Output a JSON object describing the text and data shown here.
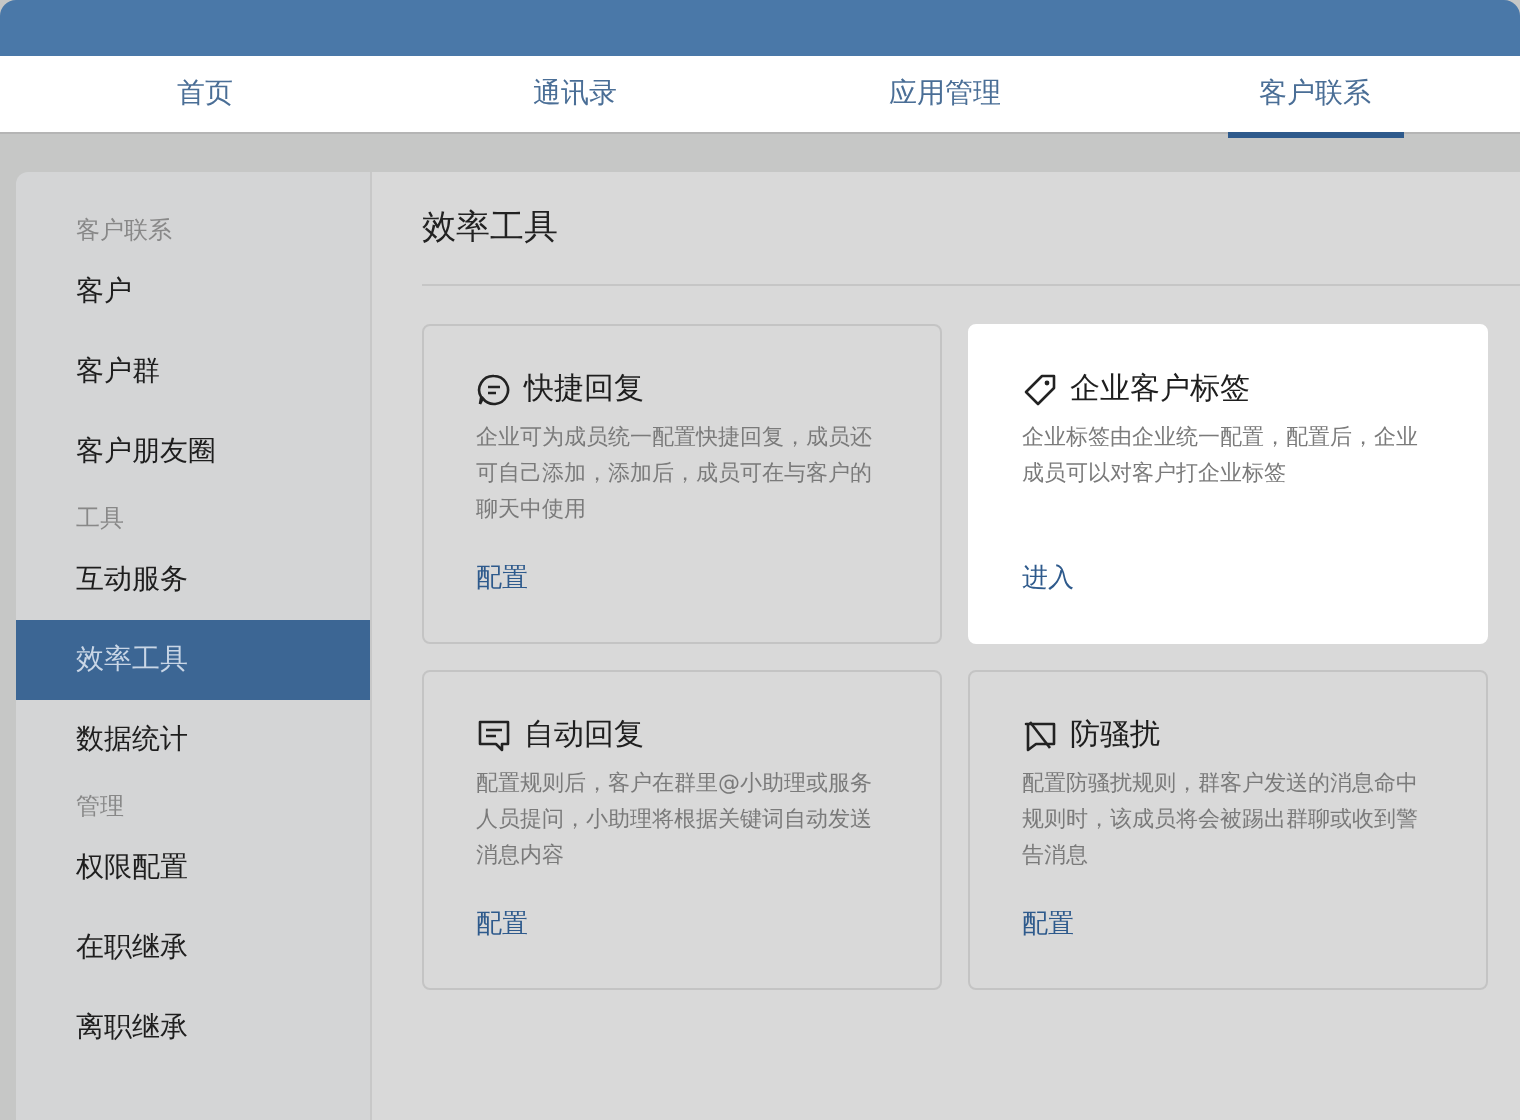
{
  "tabs": [
    {
      "label": "首页",
      "selected": false
    },
    {
      "label": "通讯录",
      "selected": false
    },
    {
      "label": "应用管理",
      "selected": false
    },
    {
      "label": "客户联系",
      "selected": true
    }
  ],
  "sidebar": {
    "groups": [
      {
        "heading": "客户联系",
        "items": [
          {
            "label": "客户",
            "selected": false
          },
          {
            "label": "客户群",
            "selected": false
          },
          {
            "label": "客户朋友圈",
            "selected": false
          }
        ]
      },
      {
        "heading": "工具",
        "items": [
          {
            "label": "互动服务",
            "selected": false
          },
          {
            "label": "效率工具",
            "selected": true
          },
          {
            "label": "数据统计",
            "selected": false
          }
        ]
      },
      {
        "heading": "管理",
        "items": [
          {
            "label": "权限配置",
            "selected": false
          },
          {
            "label": "在职继承",
            "selected": false
          },
          {
            "label": "离职继承",
            "selected": false
          }
        ]
      }
    ]
  },
  "page_title": "效率工具",
  "cards": [
    {
      "title": "快捷回复",
      "description": "企业可为成员统一配置快捷回复，成员还可自己添加，添加后，成员可在与客户的聊天中使用",
      "action": "配置",
      "highlighted": false
    },
    {
      "title": "企业客户标签",
      "description": "企业标签由企业统一配置，配置后，企业成员可以对客户打企业标签",
      "action": "进入",
      "highlighted": true
    },
    {
      "title": "自动回复",
      "description": "配置规则后，客户在群里@小助理或服务人员提问，小助理将根据关键词自动发送消息内容",
      "action": "配置",
      "highlighted": false
    },
    {
      "title": "防骚扰",
      "description": "配置防骚扰规则，群客户发送的消息命中规则时，该成员将会被踢出群聊或收到警告消息",
      "action": "配置",
      "highlighted": false
    }
  ]
}
